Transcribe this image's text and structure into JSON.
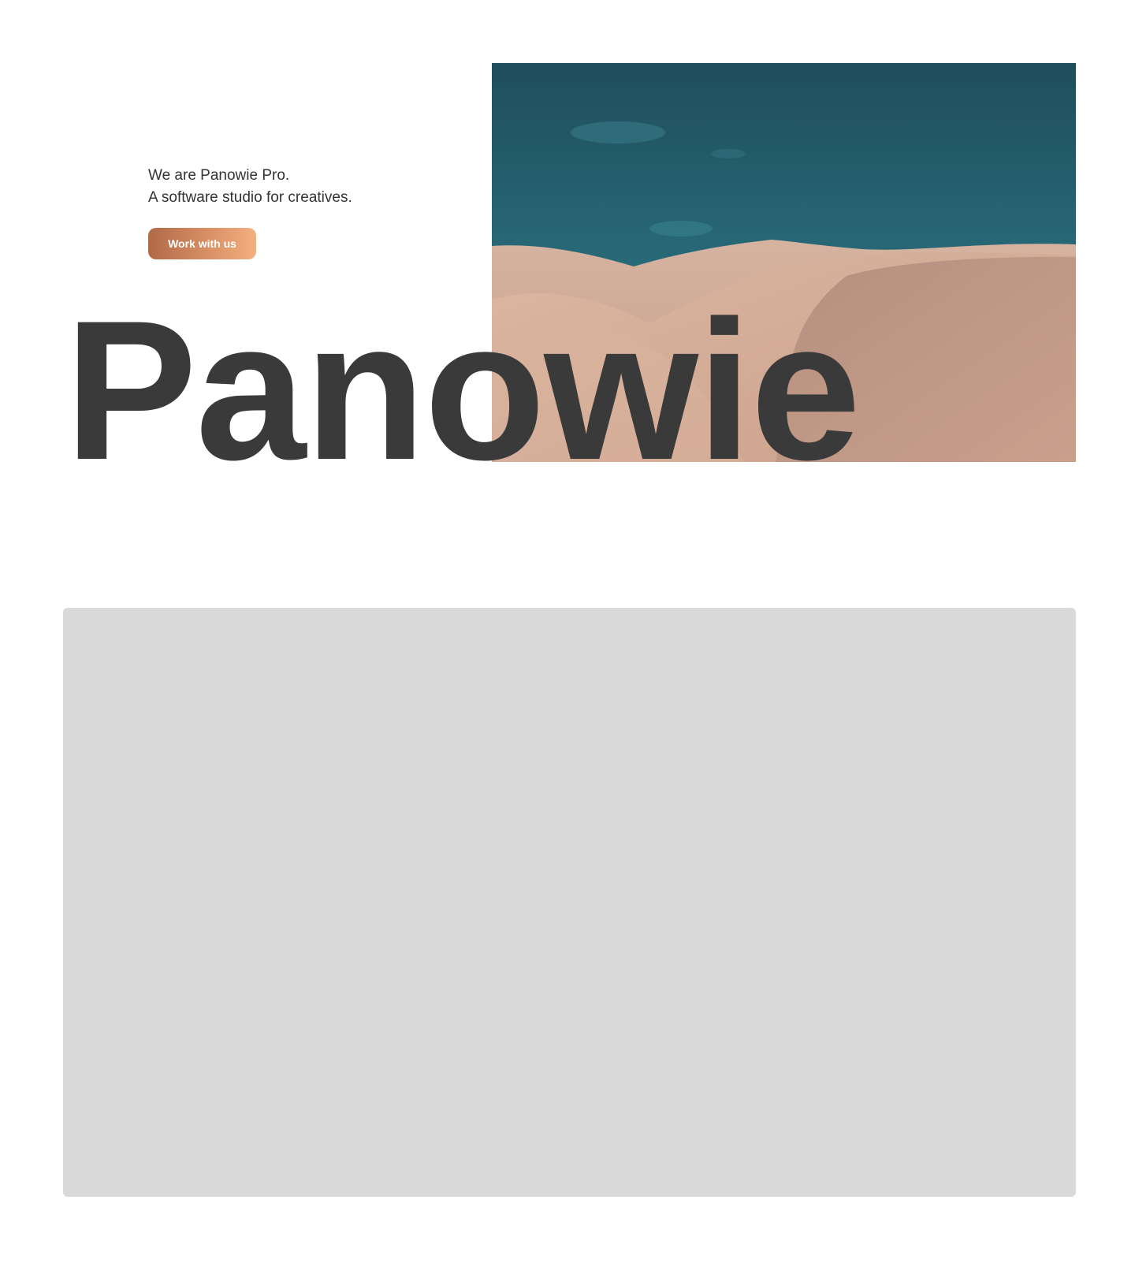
{
  "hero": {
    "tagline_line1": "We are Panowie Pro.",
    "tagline_line2": "A software studio for creatives.",
    "cta_label": "Work with us",
    "wordmark": "Panowie",
    "image_subject": "desert-dunes-photo"
  },
  "colors": {
    "text": "#3a3a3a",
    "cta_gradient_start": "#b06a48",
    "cta_gradient_end": "#f2b07f",
    "sky": "#23606f",
    "sand": "#d3aa93",
    "placeholder": "#d9d9d9",
    "background": "#ffffff"
  },
  "placeholder_panel": {
    "content": ""
  }
}
